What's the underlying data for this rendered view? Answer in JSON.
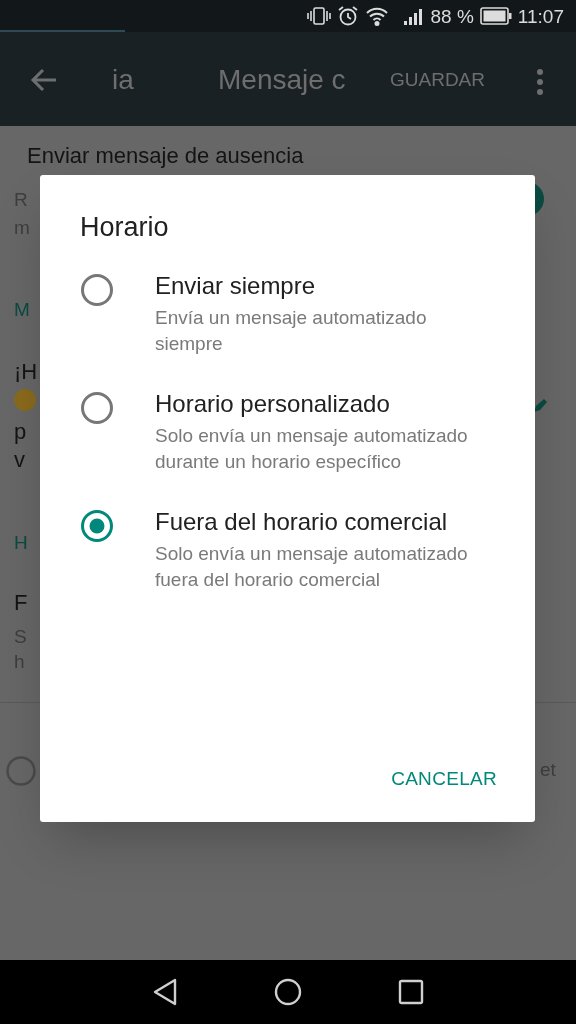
{
  "status_bar": {
    "battery": "88 %",
    "time": "11:07"
  },
  "app_bar": {
    "tab_fragment": "ia",
    "title": "Mensaje c",
    "save": "GUARDAR"
  },
  "background": {
    "heading": "Enviar mensaje de ausencia",
    "switch_on": true,
    "fragments": [
      {
        "kind": "secondary",
        "text": "R"
      },
      {
        "kind": "secondary",
        "text": "m"
      },
      {
        "kind": "section",
        "text": "M"
      },
      {
        "kind": "primary",
        "text": "¡H"
      },
      {
        "kind": "primary",
        "text": "p"
      },
      {
        "kind": "primary",
        "text": "v"
      },
      {
        "kind": "section",
        "text": "H"
      },
      {
        "kind": "primary",
        "text": "F"
      },
      {
        "kind": "secondary",
        "text": "S"
      },
      {
        "kind": "secondary",
        "text": "h"
      }
    ],
    "footer_fragment": "et"
  },
  "dialog": {
    "title": "Horario",
    "options": [
      {
        "label": "Enviar siempre",
        "description": "Envía un mensaje automatizado siempre",
        "selected": false
      },
      {
        "label": "Horario personalizado",
        "description": "Solo envía un mensaje automatizado durante un horario específico",
        "selected": false
      },
      {
        "label": "Fuera del horario comercial",
        "description": "Solo envía un mensaje automatizado fuera del horario comercial",
        "selected": true
      }
    ],
    "button": "CANCELAR"
  }
}
